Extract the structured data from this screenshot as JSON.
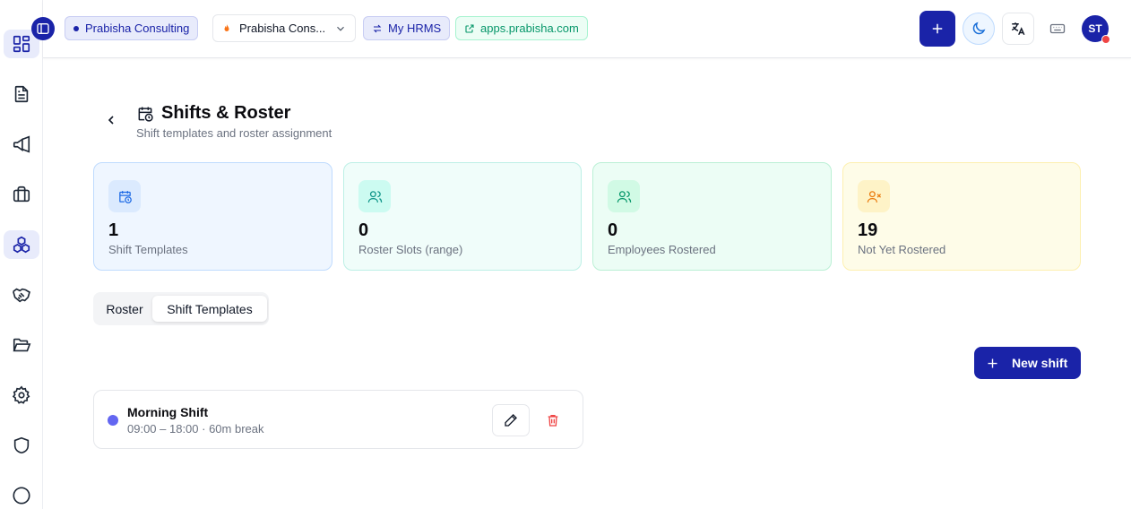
{
  "topbar": {
    "org_chip": "Prabisha Consulting",
    "org_select": "Prabisha Cons...",
    "hrms_chip": "My HRMS",
    "app_link": "apps.prabisha.com",
    "avatar_initials": "ST"
  },
  "sidebar": {
    "items": [
      {
        "name": "dashboard-icon"
      },
      {
        "name": "document-icon"
      },
      {
        "name": "megaphone-icon"
      },
      {
        "name": "briefcase-icon"
      },
      {
        "name": "boxes-icon"
      },
      {
        "name": "handshake-icon"
      },
      {
        "name": "folder-open-icon"
      },
      {
        "name": "gear-icon"
      },
      {
        "name": "shield-icon"
      },
      {
        "name": "circle-icon"
      }
    ],
    "active_index": 4
  },
  "header": {
    "title": "Shifts & Roster",
    "subtitle": "Shift templates and roster assignment"
  },
  "stats": [
    {
      "value": "1",
      "label": "Shift Templates"
    },
    {
      "value": "0",
      "label": "Roster Slots (range)"
    },
    {
      "value": "0",
      "label": "Employees Rostered"
    },
    {
      "value": "19",
      "label": "Not Yet Rostered"
    }
  ],
  "tabs": {
    "roster": "Roster",
    "templates": "Shift Templates",
    "active": "templates"
  },
  "actions": {
    "new_shift": "New shift"
  },
  "shifts": [
    {
      "name": "Morning Shift",
      "meta": "09:00 – 18:00 · 60m break",
      "color": "#6366f1"
    }
  ],
  "colors": {
    "primary": "#1a23a8",
    "danger": "#ef4444"
  }
}
